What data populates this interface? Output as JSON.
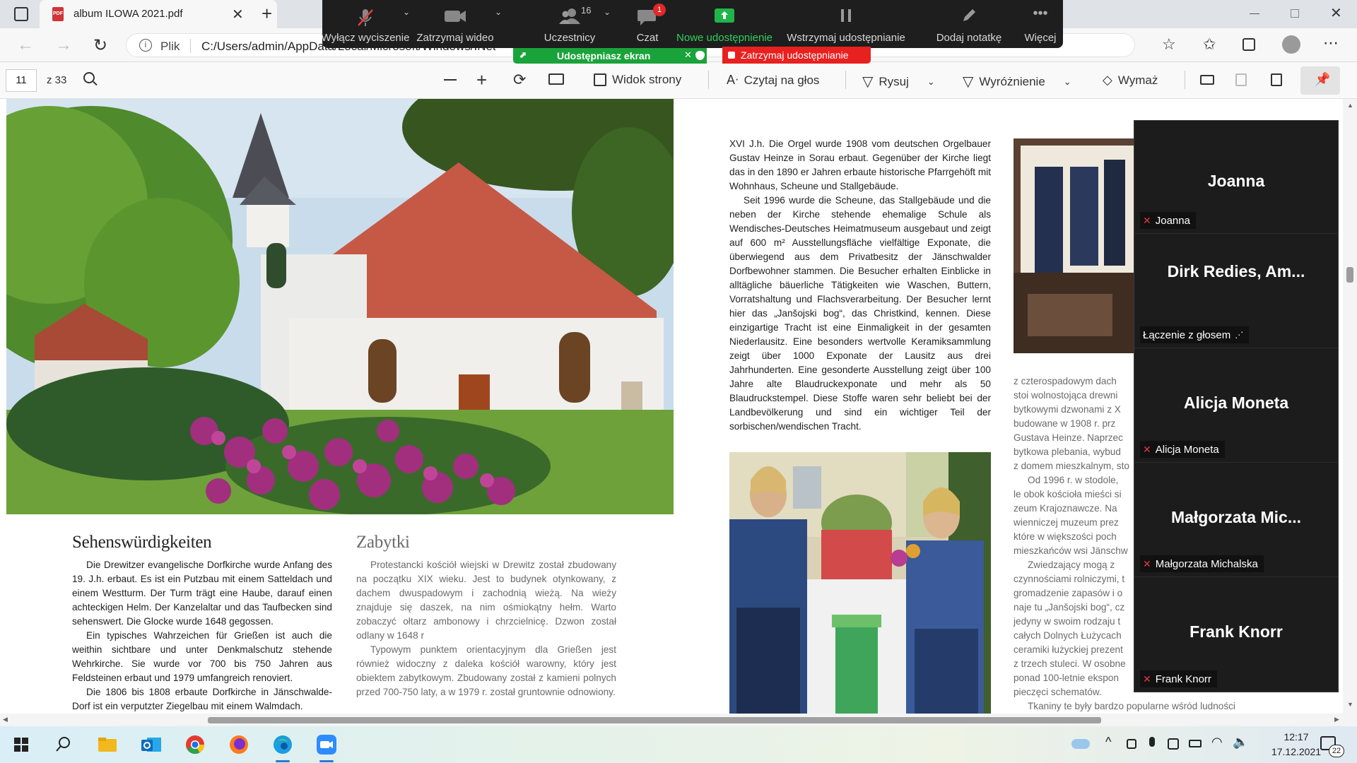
{
  "browser": {
    "tab_title": "album ILOWA 2021.pdf",
    "address_label": "Plik",
    "address": "C:/Users/admin/AppData/Local/Microsoft/Windows/INet"
  },
  "pdf_toolbar": {
    "page": "11",
    "page_total": "z 33",
    "page_view": "Widok strony",
    "read_aloud": "Czytaj na głos",
    "draw": "Rysuj",
    "highlight": "Wyróżnienie",
    "erase": "Wymaż"
  },
  "zoom": {
    "mute": "Wyłącz wyciszenie",
    "video": "Zatrzymaj wideo",
    "participants": "Uczestnicy",
    "participants_count": "16",
    "chat": "Czat",
    "chat_badge": "1",
    "new_share": "Nowe udostępnienie",
    "pause_share": "Wstrzymaj udostępnianie",
    "annotate": "Dodaj notatkę",
    "more": "Więcej",
    "sharing_banner": "Udostępniasz ekran",
    "stop_share": "Zatrzymaj udostępnianie",
    "colors": {
      "bar": "#1e1e1e",
      "green": "#1aa33a",
      "red": "#e8201f"
    }
  },
  "document": {
    "de_title": "Sehenswürdigkeiten",
    "de_paragraphs": [
      "Die Drewitzer evangelische Dorfkirche wurde Anfang des 19. J.h. erbaut. Es ist ein Putzbau mit einem Satteldach und einem Westturm. Der Turm trägt eine Haube, darauf einen achteckigen Helm. Der Kanzelaltar und das Taufbecken sind sehenswert. Die Glocke wurde 1648 gegossen.",
      "Ein typisches Wahrzeichen für Grießen ist auch die weithin sichtbare und unter Denkmalschutz stehende Wehrkirche. Sie wurde vor 700 bis 750 Jahren aus Feldsteinen erbaut und 1979 umfangreich renoviert.",
      "Die 1806 bis 1808 erbaute Dorfkirche in Jänschwalde-Dorf ist ein verputzter Ziegelbau mit einem Walmdach."
    ],
    "pl_title": "Zabytki",
    "pl_paragraphs": [
      "Protestancki kościół wiejski w Drewitz został zbudowany na początku XIX wieku. Jest to budynek otynkowany, z dachem dwuspadowym i zachodnią wieżą. Na wieży znajduje się daszek, na nim ośmiokątny hełm. Warto zobaczyć ołtarz ambonowy i chrzcielnicę. Dzwon został odlany w 1648 r",
      "Typowym punktem orientacyjnym dla Grießen jest również widoczny z daleka kościół warowny, który jest obiektem zabytkowym. Zbudowany został z kamieni polnych przed 700-750 laty, a w 1979 r. został gruntownie odnowiony."
    ],
    "right_de_paragraphs": [
      "XVI J.h. Die Orgel wurde 1908 vom deutschen Orgelbauer Gustav Heinze in Sorau erbaut. Gegenüber der Kirche liegt das in den 1890 er Jahren erbaute historische Pfarrgehöft mit Wohnhaus, Scheune und Stallgebäude.",
      "Seit 1996 wurde die Scheune, das Stallgebäude und die neben der Kirche stehende ehemalige Schule als Wendisches-Deutsches Heimatmuseum ausgebaut und zeigt auf 600 m² Ausstellungsfläche vielfältige Exponate, die überwiegend aus dem Privatbesitz der Jänschwalder Dorfbewohner stammen. Die Besucher erhalten Einblicke in alltägliche bäuerliche Tätigkeiten wie Waschen, Buttern, Vorratshaltung und Flachsverarbeitung. Der Besucher lernt hier das „Janšojski bog“, das Christkind, kennen. Diese einzigartige Tracht ist eine Einmaligkeit in der gesamten Niederlausitz. Eine besonders wertvolle Keramiksammlung zeigt über 1000 Exponate der Lausitz aus drei Jahrhunderten. Eine gesonderte Ausstellung zeigt über 100 Jahre alte Blaudruckexponate und mehr als 50 Blaudruckstempel. Diese Stoffe waren sehr beliebt bei der Landbevölkerung und sind ein wichtiger Teil der sorbischen/wendischen Tracht."
    ],
    "right_pl_lines": [
      "z czterospadowym dach",
      "stoi wolnostojąca drewni",
      "bytkowymi dzwonami z X",
      "budowane w 1908 r. prz",
      "Gustava Heinze. Naprzec",
      "bytkowa plebania, wybud",
      "z domem mieszkalnym, sto",
      "Od 1996 r. w stodole,",
      "le obok kościoła mieści si",
      "zeum Krajoznawcze. Na",
      "wienniczej muzeum prez",
      "które w większości poch",
      "mieszkańców wsi Jänschw",
      "Zwiedzający mogą z",
      "czynnościami rolniczymi, t",
      "gromadzenie zapasów i o",
      "naje tu „Janšojski bog“, cz",
      "jedyny w swoim rodzaju t",
      "całych Dolnych Łużycach",
      "ceramiki łużyckiej prezent",
      "z trzech stuleci. W osobne",
      "ponad 100-letnie ekspon",
      "pieczęci schematów.",
      "Tkaniny te były bardzo popularne wśród ludności"
    ]
  },
  "participants": [
    {
      "big": "Joanna",
      "tag": "Joanna"
    },
    {
      "big": "Dirk  Redies,  Am...",
      "tag": "Łączenie z głosem"
    },
    {
      "big": "Alicja Moneta",
      "tag": "Alicja Moneta"
    },
    {
      "big": "Małgorzata  Mic...",
      "tag": "Małgorzata Michalska"
    },
    {
      "big": "Frank Knorr",
      "tag": "Frank Knorr"
    }
  ],
  "taskbar": {
    "time": "12:17",
    "date": "17.12.2021",
    "notifications": "22"
  }
}
